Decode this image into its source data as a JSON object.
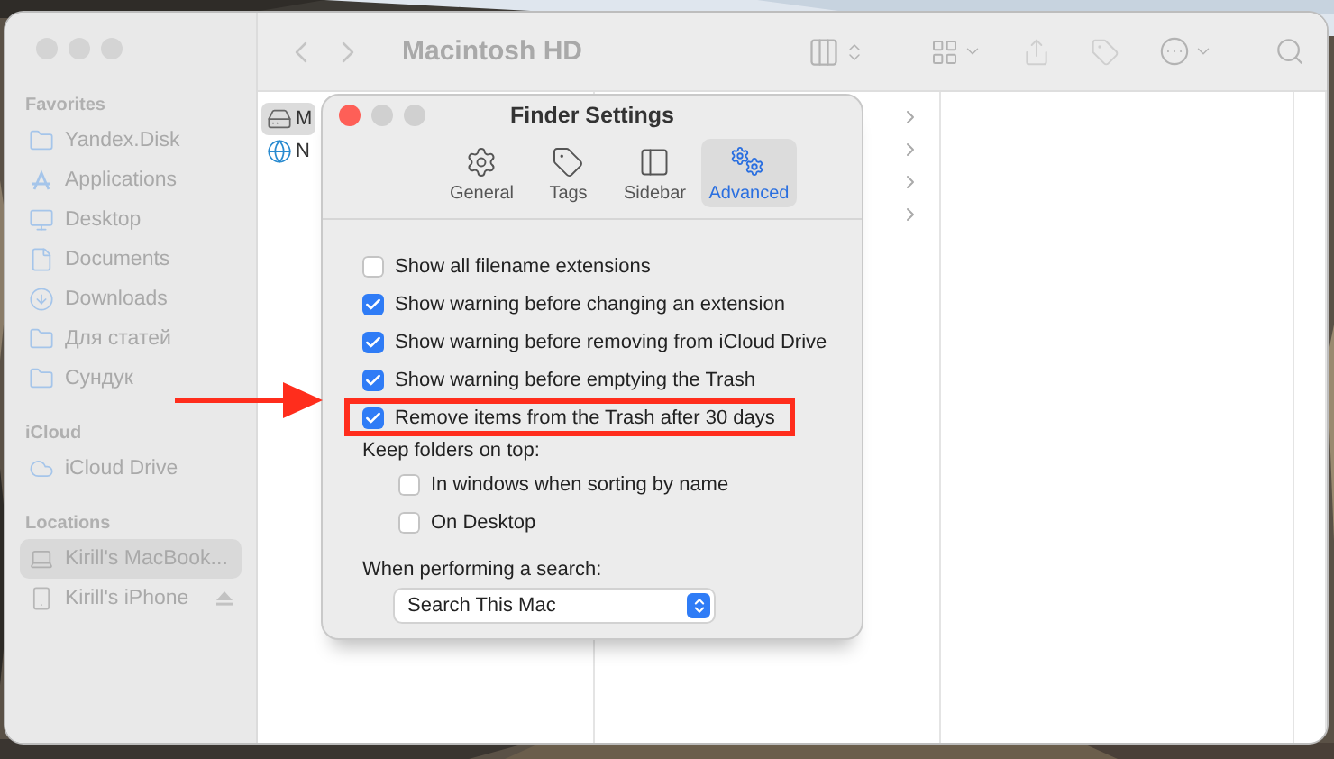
{
  "finder": {
    "window": {
      "title": "Macintosh HD"
    },
    "sidebar": {
      "sections": [
        {
          "heading": "Favorites",
          "items": [
            {
              "label": "Yandex.Disk",
              "kind": "folder",
              "selected": false
            },
            {
              "label": "Applications",
              "kind": "apps",
              "selected": false
            },
            {
              "label": "Desktop",
              "kind": "desktop",
              "selected": false
            },
            {
              "label": "Documents",
              "kind": "document",
              "selected": false
            },
            {
              "label": "Downloads",
              "kind": "download",
              "selected": false
            },
            {
              "label": "Для статей",
              "kind": "folder",
              "selected": false
            },
            {
              "label": "Сундук",
              "kind": "folder",
              "selected": false
            }
          ]
        },
        {
          "heading": "iCloud",
          "items": [
            {
              "label": "iCloud Drive",
              "kind": "cloud",
              "selected": false
            }
          ]
        },
        {
          "heading": "Locations",
          "items": [
            {
              "label": "Kirill's MacBook...",
              "kind": "laptop",
              "selected": true
            },
            {
              "label": "Kirill's iPhone",
              "kind": "phone",
              "selected": false,
              "eject": true
            }
          ]
        }
      ]
    },
    "column_1": [
      {
        "label": "M",
        "kind": "disk",
        "selected": true
      },
      {
        "label": "N",
        "kind": "network",
        "selected": false
      }
    ]
  },
  "settings": {
    "title": "Finder Settings",
    "tabs": [
      {
        "label": "General",
        "kind": "general",
        "selected": false
      },
      {
        "label": "Tags",
        "kind": "tags",
        "selected": false
      },
      {
        "label": "Sidebar",
        "kind": "sidebar",
        "selected": false
      },
      {
        "label": "Advanced",
        "kind": "advanced",
        "selected": true
      }
    ],
    "options": [
      {
        "label": "Show all filename extensions",
        "checked": false,
        "highlighted": false
      },
      {
        "label": "Show warning before changing an extension",
        "checked": true,
        "highlighted": false
      },
      {
        "label": "Show warning before removing from iCloud Drive",
        "checked": true,
        "highlighted": false
      },
      {
        "label": "Show warning before emptying the Trash",
        "checked": true,
        "highlighted": false
      },
      {
        "label": "Remove items from the Trash after 30 days",
        "checked": true,
        "highlighted": true
      }
    ],
    "keep_folders": {
      "label": "Keep folders on top:",
      "options": [
        {
          "label": "In windows when sorting by name",
          "checked": false
        },
        {
          "label": "On Desktop",
          "checked": false
        }
      ]
    },
    "search": {
      "label": "When performing a search:",
      "value": "Search This Mac"
    }
  }
}
